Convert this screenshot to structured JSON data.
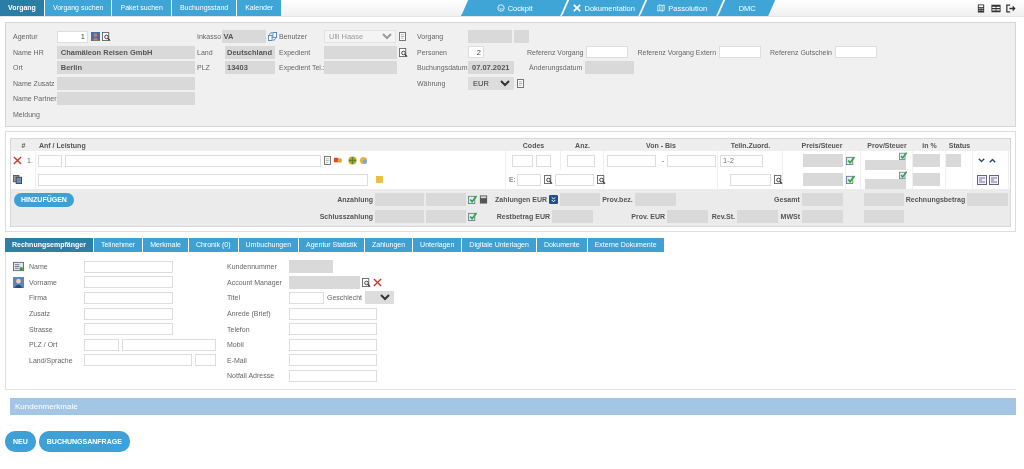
{
  "top_tabs": [
    {
      "label": "Vorgang",
      "selected": true
    },
    {
      "label": "Vorgang suchen",
      "selected": false
    },
    {
      "label": "Paket suchen",
      "selected": false
    },
    {
      "label": "Buchungsstand",
      "selected": false
    },
    {
      "label": "Kalender",
      "selected": false
    }
  ],
  "nav_links": [
    {
      "label": "Cockpit",
      "kind": "cockpit"
    },
    {
      "label": "Dokumentation",
      "kind": "tools"
    },
    {
      "label": "Passolution",
      "kind": "map"
    },
    {
      "label": "DMC",
      "kind": "plain"
    }
  ],
  "header": {
    "columns": [
      {
        "fields": [
          {
            "label": "Agentur",
            "kind": "input",
            "value": "1"
          },
          {
            "label": "Name HR",
            "kind": "readonly",
            "value": "Chamäleon Reisen GmbH"
          },
          {
            "label": "Ort",
            "kind": "readonly",
            "value": "Berlin"
          },
          {
            "label": "Name Zusatz",
            "kind": "readonly"
          },
          {
            "label": "Name Partner",
            "kind": "readonly"
          },
          {
            "label": "Meldung",
            "kind": "none"
          }
        ]
      },
      {
        "fields": [
          {
            "label": "Inkasso",
            "kind": "readonly",
            "value": "VA"
          },
          {
            "label": "Land",
            "kind": "readonly",
            "value": "Deutschland"
          },
          {
            "label": "PLZ",
            "kind": "readonly",
            "value": "13403"
          }
        ]
      },
      {
        "fields": [
          {
            "label": "Benutzer",
            "kind": "select",
            "value": "Ulli Haase",
            "disabled": true
          },
          {
            "label": "Expedient",
            "kind": "readonly"
          },
          {
            "label": "Expedient Tel.:",
            "kind": "readonly"
          }
        ]
      },
      {
        "fields": [
          {
            "label": "Vorgang",
            "kind": "double"
          },
          {
            "label": "Personen",
            "kind": "input",
            "value": "2",
            "extras": [
              {
                "label": "Referenz Vorgang",
                "kind": "input"
              },
              {
                "label": "Referenz Vorgang Extern",
                "kind": "input"
              },
              {
                "label": "Referenz Gutschein",
                "kind": "input"
              }
            ]
          },
          {
            "label": "Buchungsdatum",
            "kind": "readonly",
            "value": "07.07.2021",
            "extras": [
              {
                "label": "Änderungsdatum",
                "kind": "readonly"
              }
            ]
          },
          {
            "label": "Währung",
            "kind": "select",
            "value": "EUR",
            "disabled": false
          }
        ]
      }
    ]
  },
  "positions": {
    "columns": [
      "#",
      "Anf / Leistung",
      "Codes",
      "Anz.",
      "Von - Bis",
      "Teiln.Zuord.",
      "Preis/Steuer",
      "Prov/Steuer",
      "in %",
      "Status"
    ],
    "rows": [
      {
        "number": "1.",
        "range_separator": "-",
        "assignment": "1-2",
        "code_label": "E:"
      }
    ],
    "add_button": "HINZUFÜGEN",
    "totals": [
      [
        {
          "label": "Anzahlung",
          "kind": "deposit"
        },
        {
          "label": "Zahlungen EUR",
          "kind": "expand"
        },
        {
          "label": "Prov.bez.",
          "kind": "box"
        },
        {
          "label": "Gesamt",
          "kind": "double"
        },
        {
          "label": "Rechnungsbetrag",
          "kind": "box"
        }
      ],
      [
        {
          "label": "Schlusszahlung",
          "kind": "final"
        },
        {
          "label": "Restbetrag EUR",
          "kind": "box"
        },
        {
          "label": "Prov. EUR",
          "kind": "box"
        },
        {
          "label": "Rev.St.",
          "kind": "box"
        },
        {
          "label": "MWSt",
          "kind": "double"
        }
      ]
    ]
  },
  "detail_tabs": [
    {
      "label": "Rechnungsempfänger",
      "selected": true
    },
    {
      "label": "Teilnehmer",
      "selected": false
    },
    {
      "label": "Merkmale",
      "selected": false
    },
    {
      "label": "Chronik (0)",
      "selected": false
    },
    {
      "label": "Umbuchungen",
      "selected": false
    },
    {
      "label": "Agentur Statistik",
      "selected": false
    },
    {
      "label": "Zahlungen",
      "selected": false
    },
    {
      "label": "Unterlagen",
      "selected": false
    },
    {
      "label": "Digitale Unterlagen",
      "selected": false
    },
    {
      "label": "Dokumente",
      "selected": false
    },
    {
      "label": "Externe Dokumente",
      "selected": false
    }
  ],
  "recipient": {
    "left": [
      {
        "label": "Name",
        "kind": "text"
      },
      {
        "label": "Vorname",
        "kind": "text"
      },
      {
        "label": "Firma",
        "kind": "text"
      },
      {
        "label": "Zusatz",
        "kind": "text"
      },
      {
        "label": "Strasse",
        "kind": "text"
      },
      {
        "label": "PLZ / Ort",
        "kind": "pair"
      },
      {
        "label": "Land/Sprache",
        "kind": "pair_short"
      }
    ],
    "right": [
      {
        "label": "Kundennummer",
        "kind": "readonly"
      },
      {
        "label": "Account Manager",
        "kind": "lookup"
      },
      {
        "label": "Titel",
        "kind": "title",
        "extra_label": "Geschlecht"
      },
      {
        "label": "Anrede (Brief)",
        "kind": "text"
      },
      {
        "label": "Telefon",
        "kind": "text"
      },
      {
        "label": "Mobil",
        "kind": "text"
      },
      {
        "label": "E-Mail",
        "kind": "text"
      },
      {
        "label": "Notfall Adresse",
        "kind": "text"
      }
    ]
  },
  "section_title": "Kundenmerkmale",
  "buttons": [
    "NEU",
    "BUCHUNGSANFRAGE"
  ]
}
